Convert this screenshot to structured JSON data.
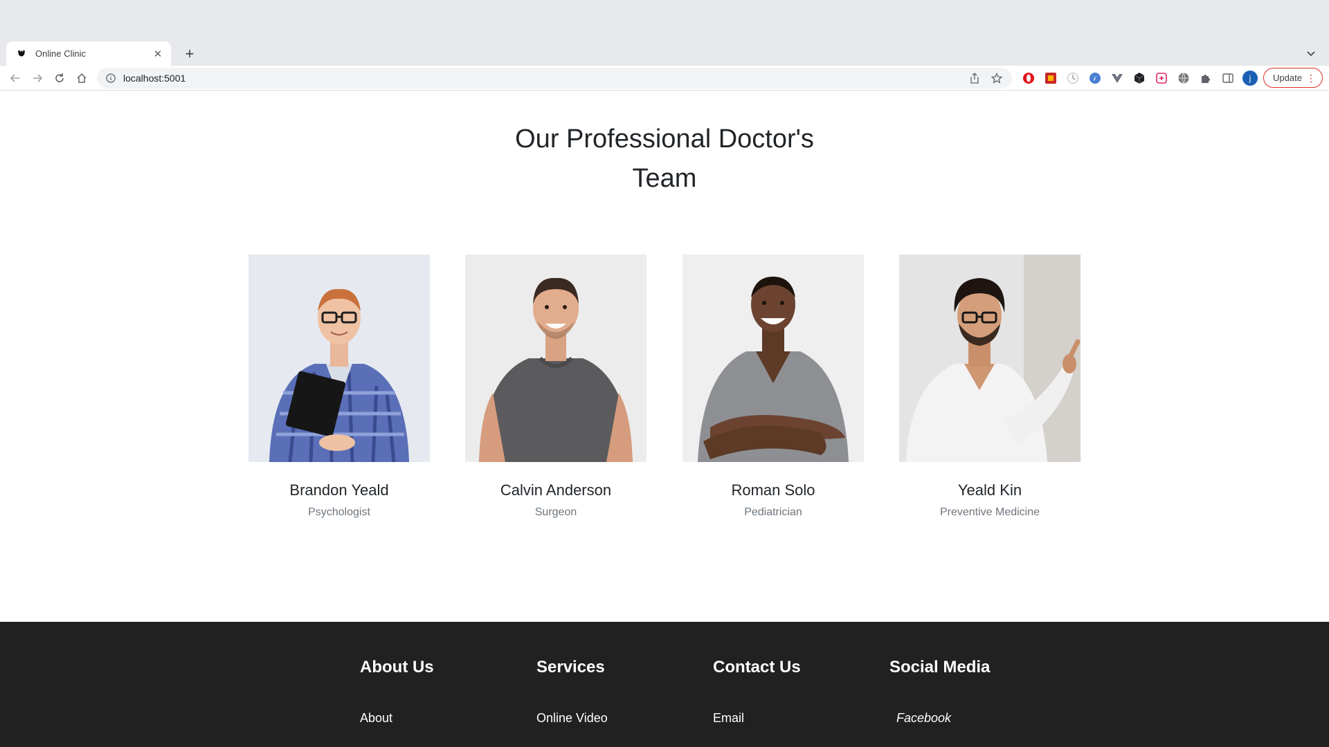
{
  "browser": {
    "tab_title": "Online Clinic",
    "url": "localhost:5001",
    "update_label": "Update",
    "avatar_letter": "j",
    "new_tab_symbol": "+"
  },
  "section": {
    "title_line1": "Our Professional Doctor's",
    "title_line2": "Team"
  },
  "doctors": [
    {
      "name": "Brandon Yeald",
      "role": "Psychologist"
    },
    {
      "name": "Calvin Anderson",
      "role": "Surgeon"
    },
    {
      "name": "Roman Solo",
      "role": "Pediatrician"
    },
    {
      "name": "Yeald Kin",
      "role": "Preventive Medicine"
    }
  ],
  "footer": {
    "columns": [
      {
        "heading": "About Us",
        "link": "About"
      },
      {
        "heading": "Services",
        "link": "Online Video"
      },
      {
        "heading": "Contact Us",
        "link": "Email"
      },
      {
        "heading": "Social Media",
        "link": "Facebook"
      }
    ]
  },
  "colors": {
    "footer_bg": "#212121",
    "update_border": "#d93025",
    "avatar_bg": "#1a5fb4"
  }
}
